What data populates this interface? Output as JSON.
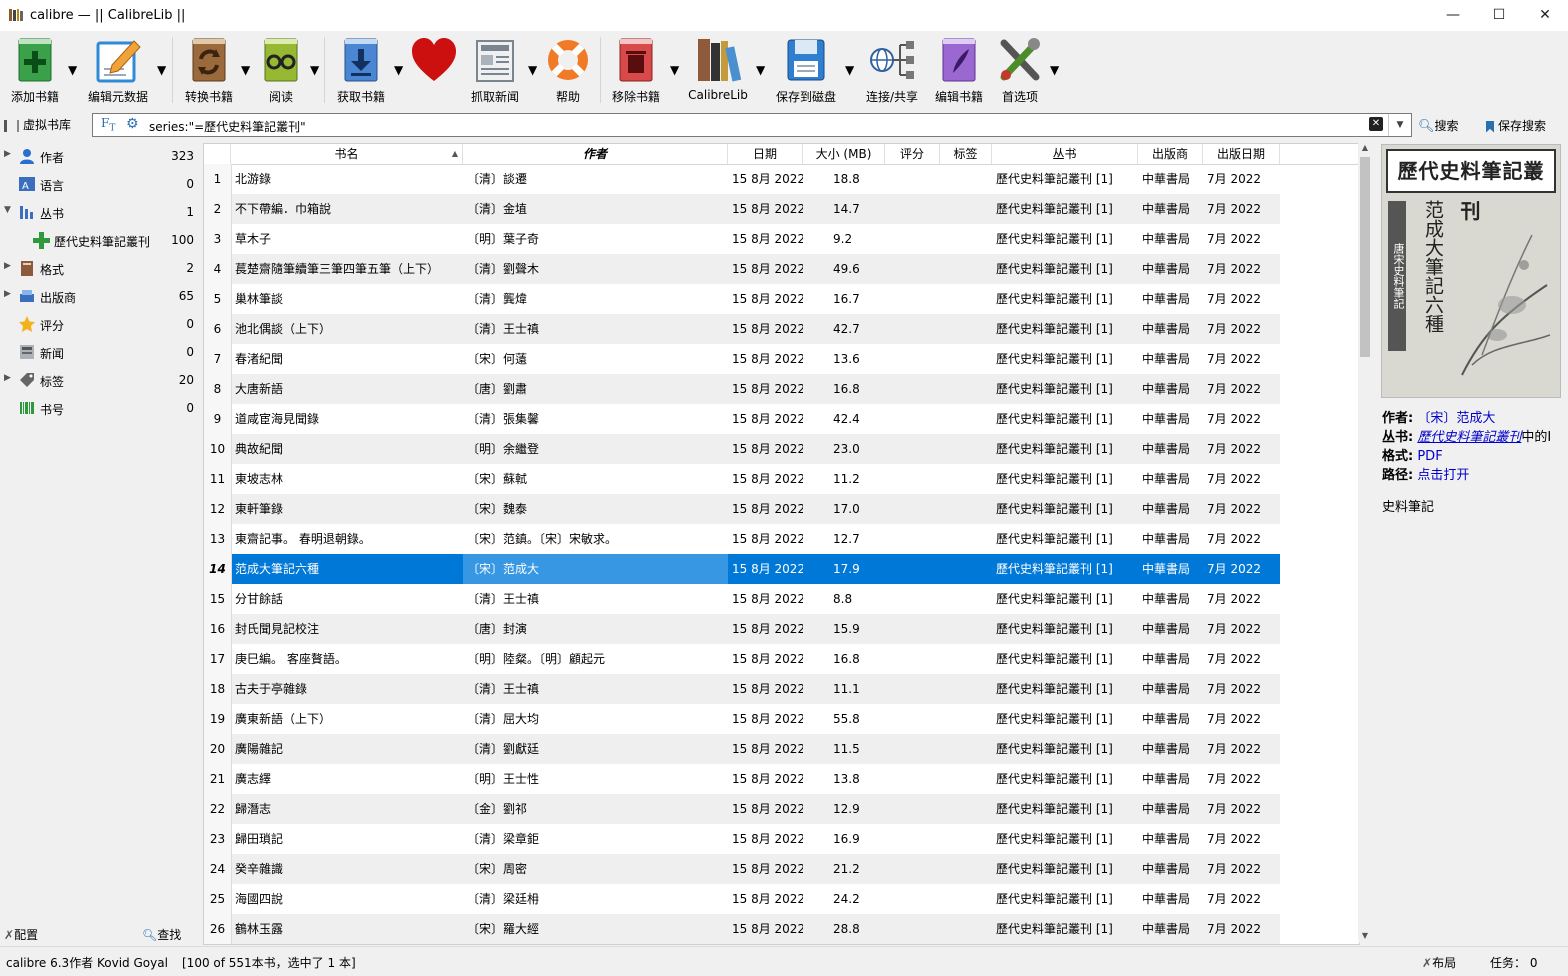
{
  "window": {
    "title": "calibre — || CalibreLib ||",
    "minimize": "—",
    "maximize": "☐",
    "close": "✕"
  },
  "toolbar": {
    "items": [
      {
        "label": "添加书籍",
        "icon": "add-book-icon",
        "color": "#2e9a3c"
      },
      {
        "label": "编辑元数据",
        "icon": "edit-metadata-icon",
        "color": "#2f8ad8"
      },
      {
        "label": "转换书籍",
        "icon": "convert-book-icon",
        "color": "#8c5a2e"
      },
      {
        "label": "阅读",
        "icon": "read-book-icon",
        "color": "#8ab22c"
      },
      {
        "label": "获取书籍",
        "icon": "get-books-icon",
        "color": "#3a76c8"
      },
      {
        "label": "",
        "icon": "donate-heart-icon",
        "color": "#cc1010"
      },
      {
        "label": "抓取新闻",
        "icon": "fetch-news-icon",
        "color": "#9aa4ae"
      },
      {
        "label": "帮助",
        "icon": "help-lifebuoy-icon",
        "color": "#f07a26"
      },
      {
        "label": "移除书籍",
        "icon": "remove-book-icon",
        "color": "#d63a3a"
      },
      {
        "label": "CalibreLib",
        "icon": "library-icon",
        "color": "#8d5b3b"
      },
      {
        "label": "保存到磁盘",
        "icon": "save-disk-icon",
        "color": "#2f7fd1"
      },
      {
        "label": "连接/共享",
        "icon": "connect-share-icon",
        "color": "#3060a0"
      },
      {
        "label": "编辑书籍",
        "icon": "edit-book-icon",
        "color": "#8e5fc9"
      },
      {
        "label": "首选项",
        "icon": "preferences-icon",
        "color": "#5a8a2a"
      }
    ]
  },
  "search": {
    "virtual_library": "虚拟书库",
    "query": "series:\"=歷代史料筆記叢刊\"",
    "search_label": "搜索",
    "save_label": "保存搜索"
  },
  "tag_browser": {
    "items": [
      {
        "name": "作者",
        "count": "323",
        "icon": "author-icon",
        "expander": "▶",
        "indent": 0
      },
      {
        "name": "语言",
        "count": "0",
        "icon": "language-icon",
        "expander": "",
        "indent": 0
      },
      {
        "name": "丛书",
        "count": "1",
        "icon": "series-icon",
        "expander": "▼",
        "indent": 0
      },
      {
        "name": "歷代史料筆記叢刊",
        "count": "100",
        "icon": "plus-icon",
        "expander": "",
        "indent": 1
      },
      {
        "name": "格式",
        "count": "2",
        "icon": "format-icon",
        "expander": "▶",
        "indent": 0
      },
      {
        "name": "出版商",
        "count": "65",
        "icon": "publisher-icon",
        "expander": "▶",
        "indent": 0
      },
      {
        "name": "评分",
        "count": "0",
        "icon": "rating-star-icon",
        "expander": "",
        "indent": 0
      },
      {
        "name": "新闻",
        "count": "0",
        "icon": "news-icon",
        "expander": "",
        "indent": 0
      },
      {
        "name": "标签",
        "count": "20",
        "icon": "tag-icon",
        "expander": "▶",
        "indent": 0
      },
      {
        "name": "书号",
        "count": "0",
        "icon": "barcode-icon",
        "expander": "",
        "indent": 0
      }
    ],
    "configure": "配置",
    "find": "查找"
  },
  "table": {
    "columns": [
      "书名",
      "作者",
      "日期",
      "大小 (MB)",
      "评分",
      "标签",
      "丛书",
      "出版商",
      "出版日期"
    ],
    "sort_indicator": "▲",
    "rows": [
      {
        "n": "1",
        "title": "北游錄",
        "author": "〔清〕談遷",
        "date": "15 8月 2022",
        "size": "18.8",
        "series": "歷代史料筆記叢刊 [1]",
        "publisher": "中華書局",
        "pubdate": "7月 2022"
      },
      {
        "n": "2",
        "title": "不下帶編．巾箱說",
        "author": "〔清〕金埴",
        "date": "15 8月 2022",
        "size": "14.7",
        "series": "歷代史料筆記叢刊 [1]",
        "publisher": "中華書局",
        "pubdate": "7月 2022"
      },
      {
        "n": "3",
        "title": "草木子",
        "author": "〔明〕葉子奇",
        "date": "15 8月 2022",
        "size": "9.2",
        "series": "歷代史料筆記叢刊 [1]",
        "publisher": "中華書局",
        "pubdate": "7月 2022"
      },
      {
        "n": "4",
        "title": "萇楚齋隨筆續筆三筆四筆五筆（上下）",
        "author": "〔清〕劉聲木",
        "date": "15 8月 2022",
        "size": "49.6",
        "series": "歷代史料筆記叢刊 [1]",
        "publisher": "中華書局",
        "pubdate": "7月 2022"
      },
      {
        "n": "5",
        "title": "巢林筆談",
        "author": "〔清〕龔煒",
        "date": "15 8月 2022",
        "size": "16.7",
        "series": "歷代史料筆記叢刊 [1]",
        "publisher": "中華書局",
        "pubdate": "7月 2022"
      },
      {
        "n": "6",
        "title": "池北偶談（上下）",
        "author": "〔清〕王士禛",
        "date": "15 8月 2022",
        "size": "42.7",
        "series": "歷代史料筆記叢刊 [1]",
        "publisher": "中華書局",
        "pubdate": "7月 2022"
      },
      {
        "n": "7",
        "title": "春渚紀聞",
        "author": "〔宋〕何薳",
        "date": "15 8月 2022",
        "size": "13.6",
        "series": "歷代史料筆記叢刊 [1]",
        "publisher": "中華書局",
        "pubdate": "7月 2022"
      },
      {
        "n": "8",
        "title": "大唐新語",
        "author": "〔唐〕劉肅",
        "date": "15 8月 2022",
        "size": "16.8",
        "series": "歷代史料筆記叢刊 [1]",
        "publisher": "中華書局",
        "pubdate": "7月 2022"
      },
      {
        "n": "9",
        "title": "道咸宦海見聞錄",
        "author": "〔清〕張集馨",
        "date": "15 8月 2022",
        "size": "42.4",
        "series": "歷代史料筆記叢刊 [1]",
        "publisher": "中華書局",
        "pubdate": "7月 2022"
      },
      {
        "n": "10",
        "title": "典故紀聞",
        "author": "〔明〕余繼登",
        "date": "15 8月 2022",
        "size": "23.0",
        "series": "歷代史料筆記叢刊 [1]",
        "publisher": "中華書局",
        "pubdate": "7月 2022"
      },
      {
        "n": "11",
        "title": "東坡志林",
        "author": "〔宋〕蘇軾",
        "date": "15 8月 2022",
        "size": "11.2",
        "series": "歷代史料筆記叢刊 [1]",
        "publisher": "中華書局",
        "pubdate": "7月 2022"
      },
      {
        "n": "12",
        "title": "東軒筆錄",
        "author": "〔宋〕魏泰",
        "date": "15 8月 2022",
        "size": "17.0",
        "series": "歷代史料筆記叢刊 [1]",
        "publisher": "中華書局",
        "pubdate": "7月 2022"
      },
      {
        "n": "13",
        "title": "東齋記事。 春明退朝錄。",
        "author": "〔宋〕范鎮。〔宋〕宋敏求。",
        "date": "15 8月 2022",
        "size": "12.7",
        "series": "歷代史料筆記叢刊 [1]",
        "publisher": "中華書局",
        "pubdate": "7月 2022"
      },
      {
        "n": "14",
        "title": "范成大筆記六種",
        "author": "〔宋〕范成大",
        "date": "15 8月 2022",
        "size": "17.9",
        "series": "歷代史料筆記叢刊 [1]",
        "publisher": "中華書局",
        "pubdate": "7月 2022",
        "selected": true
      },
      {
        "n": "15",
        "title": "分甘餘話",
        "author": "〔清〕王士禛",
        "date": "15 8月 2022",
        "size": "8.8",
        "series": "歷代史料筆記叢刊 [1]",
        "publisher": "中華書局",
        "pubdate": "7月 2022"
      },
      {
        "n": "16",
        "title": "封氏聞見記校注",
        "author": "〔唐〕封演",
        "date": "15 8月 2022",
        "size": "15.9",
        "series": "歷代史料筆記叢刊 [1]",
        "publisher": "中華書局",
        "pubdate": "7月 2022"
      },
      {
        "n": "17",
        "title": "庚巳編。 客座贅語。",
        "author": "〔明〕陸粲。〔明〕顧起元",
        "date": "15 8月 2022",
        "size": "16.8",
        "series": "歷代史料筆記叢刊 [1]",
        "publisher": "中華書局",
        "pubdate": "7月 2022"
      },
      {
        "n": "18",
        "title": "古夫于亭雜錄",
        "author": "〔清〕王士禛",
        "date": "15 8月 2022",
        "size": "11.1",
        "series": "歷代史料筆記叢刊 [1]",
        "publisher": "中華書局",
        "pubdate": "7月 2022"
      },
      {
        "n": "19",
        "title": "廣東新語（上下）",
        "author": "〔清〕屈大均",
        "date": "15 8月 2022",
        "size": "55.8",
        "series": "歷代史料筆記叢刊 [1]",
        "publisher": "中華書局",
        "pubdate": "7月 2022"
      },
      {
        "n": "20",
        "title": "廣陽雜記",
        "author": "〔清〕劉獻廷",
        "date": "15 8月 2022",
        "size": "11.5",
        "series": "歷代史料筆記叢刊 [1]",
        "publisher": "中華書局",
        "pubdate": "7月 2022"
      },
      {
        "n": "21",
        "title": "廣志繹",
        "author": "〔明〕王士性",
        "date": "15 8月 2022",
        "size": "13.8",
        "series": "歷代史料筆記叢刊 [1]",
        "publisher": "中華書局",
        "pubdate": "7月 2022"
      },
      {
        "n": "22",
        "title": "歸潛志",
        "author": "〔金〕劉祁",
        "date": "15 8月 2022",
        "size": "12.9",
        "series": "歷代史料筆記叢刊 [1]",
        "publisher": "中華書局",
        "pubdate": "7月 2022"
      },
      {
        "n": "23",
        "title": "歸田瑣記",
        "author": "〔清〕梁章鉅",
        "date": "15 8月 2022",
        "size": "16.9",
        "series": "歷代史料筆記叢刊 [1]",
        "publisher": "中華書局",
        "pubdate": "7月 2022"
      },
      {
        "n": "24",
        "title": "癸辛雜識",
        "author": "〔宋〕周密",
        "date": "15 8月 2022",
        "size": "21.2",
        "series": "歷代史料筆記叢刊 [1]",
        "publisher": "中華書局",
        "pubdate": "7月 2022"
      },
      {
        "n": "25",
        "title": "海國四說",
        "author": "〔清〕梁廷枏",
        "date": "15 8月 2022",
        "size": "24.2",
        "series": "歷代史料筆記叢刊 [1]",
        "publisher": "中華書局",
        "pubdate": "7月 2022"
      },
      {
        "n": "26",
        "title": "鶴林玉露",
        "author": "〔宋〕羅大經",
        "date": "15 8月 2022",
        "size": "28.8",
        "series": "歷代史料筆記叢刊 [1]",
        "publisher": "中華書局",
        "pubdate": "7月 2022"
      }
    ]
  },
  "details": {
    "cover_title": "歷代史料筆記叢刊",
    "cover_book": "范成大筆記六種",
    "cover_side": "唐宋史料筆記",
    "author_label": "作者:",
    "author_value": "〔宋〕范成大",
    "series_label": "丛书:",
    "series_value": "歷代史料筆記叢刊",
    "series_suffix": "中的I",
    "format_label": "格式:",
    "format_value": "PDF",
    "path_label": "路径:",
    "path_value": "点击打开",
    "tags_text": "史料筆記"
  },
  "status": {
    "left": "calibre 6.3作者 Kovid Goyal",
    "count": "[100 of 551本书，选中了 1 本]",
    "layout": "布局",
    "jobs": "任务： 0"
  }
}
